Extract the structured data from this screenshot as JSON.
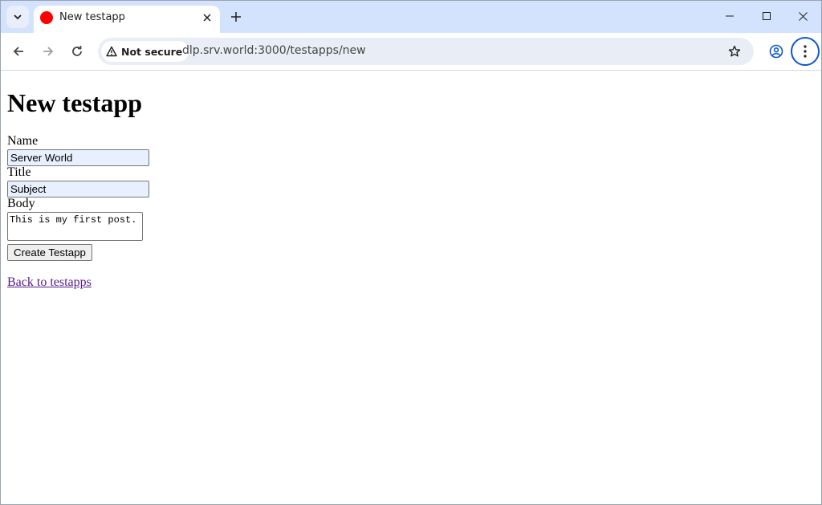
{
  "browser": {
    "tab": {
      "title": "New testapp",
      "favicon_color": "#ff0000"
    },
    "security_label": "Not secure",
    "url": "dlp.srv.world:3000/testapps/new"
  },
  "page": {
    "title": "New testapp",
    "fields": {
      "name": {
        "label": "Name",
        "value": "Server World"
      },
      "title": {
        "label": "Title",
        "value": "Subject"
      },
      "body": {
        "label": "Body",
        "value": "This is my first post."
      }
    },
    "submit_label": "Create Testapp",
    "back_link": "Back to testapps"
  },
  "colors": {
    "tabstrip": "#d3e3fd",
    "omnibox": "#e9eef6",
    "accent": "#0b57d0",
    "visited_link": "#551a8b",
    "autofill_bg": "#e8f0fe"
  }
}
